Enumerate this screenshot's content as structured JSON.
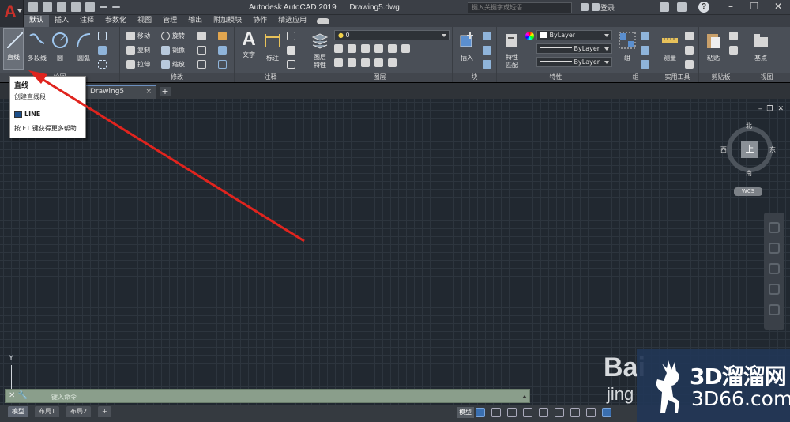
{
  "titlebar": {
    "app_name": "Autodesk AutoCAD 2019",
    "file_name": "Drawing5.dwg",
    "search_placeholder": "键入关键字或短语",
    "login": "登录",
    "help": "?"
  },
  "ribbon_tabs": [
    "默认",
    "插入",
    "注释",
    "参数化",
    "视图",
    "管理",
    "输出",
    "附加模块",
    "协作",
    "精选应用"
  ],
  "draw_panel": {
    "title": "绘图",
    "line": "直线",
    "polyline": "多段线",
    "circle": "圆",
    "arc": "圆弧"
  },
  "modify_panel": {
    "title": "修改",
    "move": "移动",
    "rotate": "旋转",
    "copy": "复制",
    "mirror": "镜像",
    "stretch": "拉伸",
    "scale": "缩放"
  },
  "annotation_panel": {
    "title": "注释",
    "text": "文字",
    "dimension": "标注"
  },
  "layers_panel": {
    "title": "图层",
    "layer_properties": "图层\n特性",
    "current_layer": "0"
  },
  "block_panel": {
    "title": "块",
    "insert": "插入"
  },
  "properties_panel": {
    "title": "特性",
    "match": "特性\n匹配",
    "color": "ByLayer",
    "linetype": "ByLayer",
    "lineweight": "ByLayer"
  },
  "groups_panel": {
    "title": "组",
    "group": "组"
  },
  "utilities_panel": {
    "title": "实用工具",
    "measure": "测量"
  },
  "clipboard_panel": {
    "title": "剪贴板",
    "paste": "粘贴"
  },
  "view_panel": {
    "title": "视图",
    "base": "基点"
  },
  "tooltip": {
    "title": "直线",
    "description": "创建直线段",
    "command": "LINE",
    "help": "按 F1 键获得更多帮助"
  },
  "file_tab": {
    "name": "Drawing5",
    "close": "×",
    "add": "+"
  },
  "viewcube": {
    "north": "北",
    "south": "南",
    "west": "西",
    "east": "东",
    "top": "上",
    "wcs": "WCS"
  },
  "ucs": {
    "y_label": "Y"
  },
  "command_line": {
    "placeholder": "键入命令"
  },
  "layout_tabs": [
    "模型",
    "布局1",
    "布局2"
  ],
  "status": {
    "model": "模型"
  },
  "watermark": {
    "baidu": "Bai",
    "baidu_sub": "jing",
    "logo": "3D溜溜网",
    "url": "3D66.com"
  },
  "colors": {
    "accent_red": "#e0241e",
    "canvas": "#212830",
    "ribbon": "#4a4f57"
  }
}
